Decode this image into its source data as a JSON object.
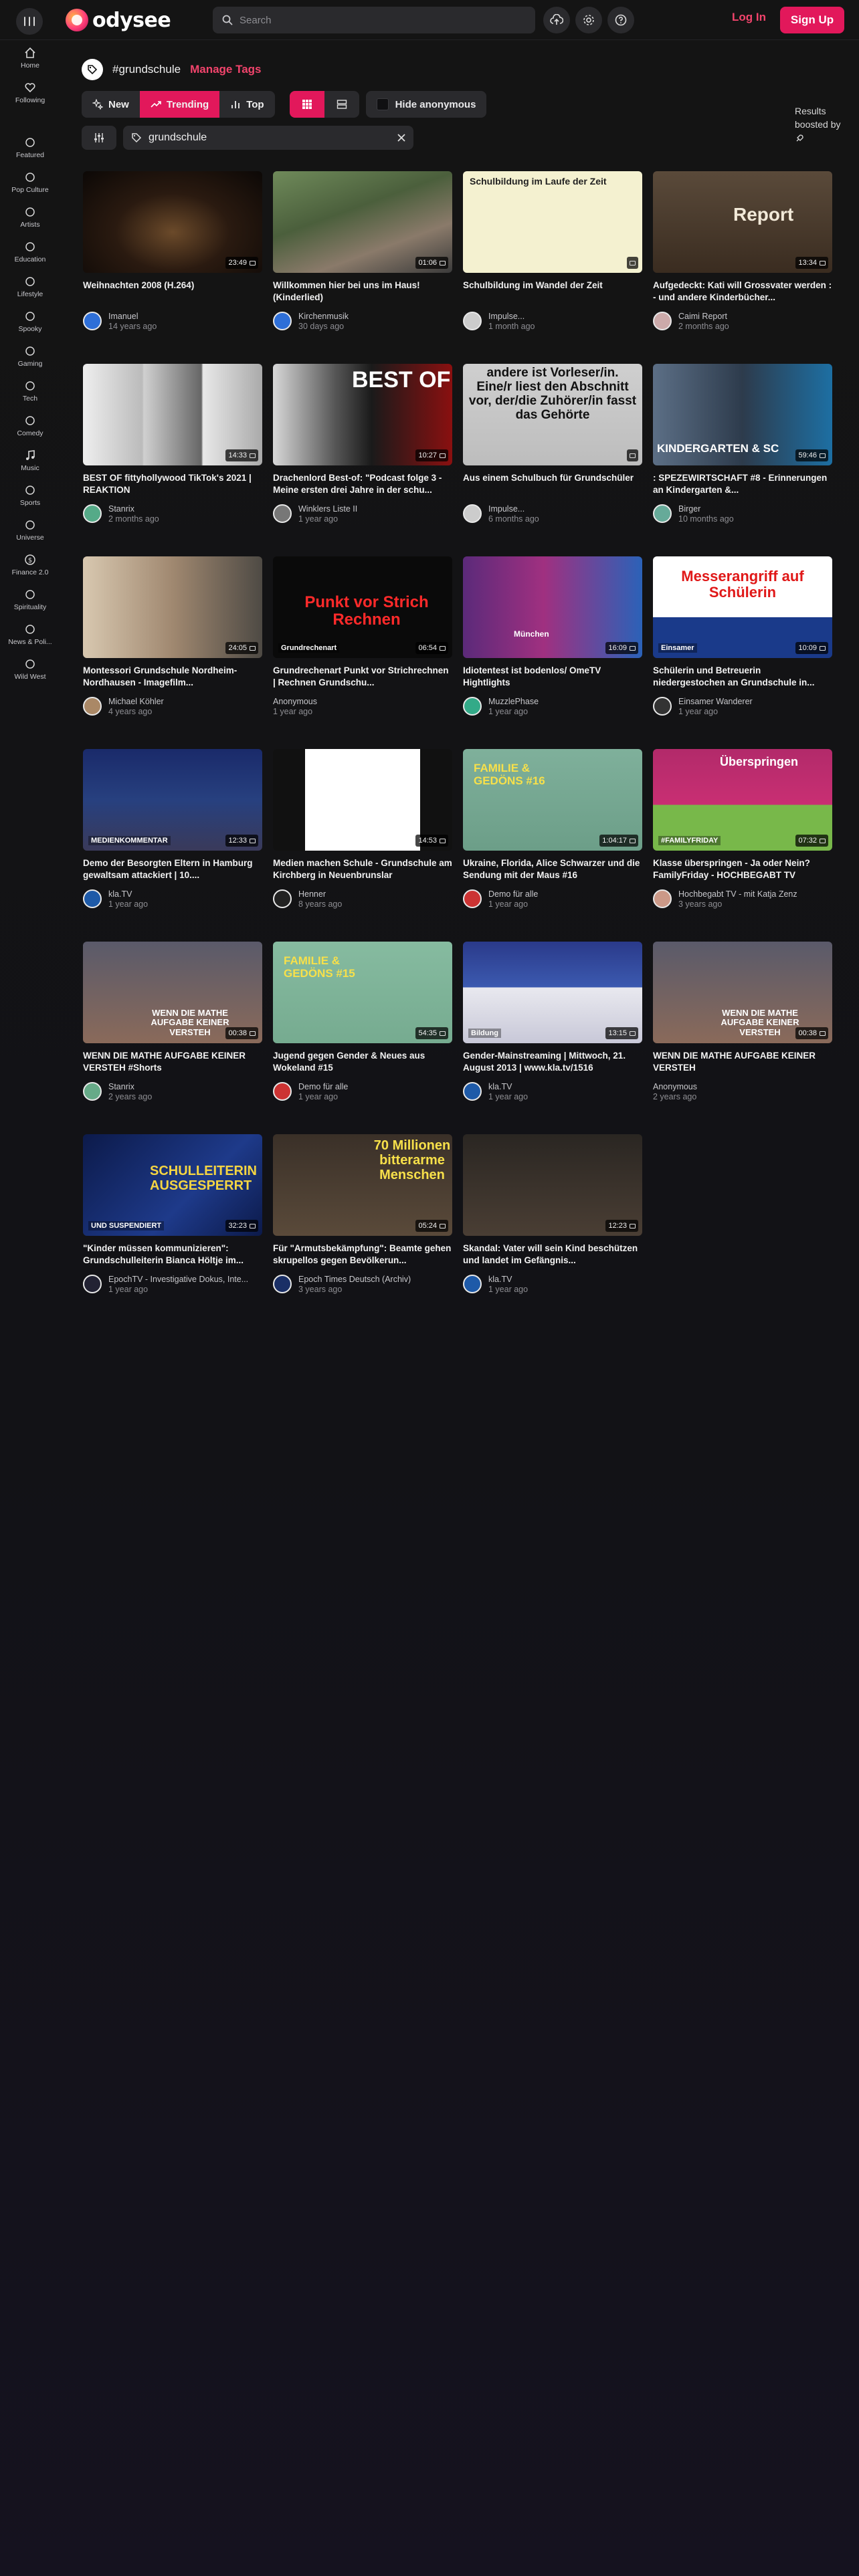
{
  "header": {
    "logo_text": "odysee",
    "search_placeholder": "Search",
    "login_label": "Log In",
    "signup_label": "Sign Up"
  },
  "sidebar": {
    "items": [
      {
        "label": "Home",
        "icon": "home-icon"
      },
      {
        "label": "Following",
        "icon": "heart-icon"
      },
      {
        "label": "Featured",
        "icon": "sparkle-icon"
      },
      {
        "label": "Pop Culture",
        "icon": "heart-outline-icon"
      },
      {
        "label": "Artists",
        "icon": "brush-icon"
      },
      {
        "label": "Education",
        "icon": "graduation-cap-icon"
      },
      {
        "label": "Lifestyle",
        "icon": "building-icon"
      },
      {
        "label": "Spooky",
        "icon": "ghost-icon"
      },
      {
        "label": "Gaming",
        "icon": "gamepad-icon"
      },
      {
        "label": "Tech",
        "icon": "chip-icon"
      },
      {
        "label": "Comedy",
        "icon": "smile-icon"
      },
      {
        "label": "Music",
        "icon": "music-note-icon"
      },
      {
        "label": "Sports",
        "icon": "basketball-icon"
      },
      {
        "label": "Universe",
        "icon": "rocket-icon"
      },
      {
        "label": "Finance 2.0",
        "icon": "dollar-icon"
      },
      {
        "label": "Spirituality",
        "icon": "lotus-icon"
      },
      {
        "label": "News & Poli...",
        "icon": "megaphone-icon"
      },
      {
        "label": "Wild West",
        "icon": "cowboy-hat-icon"
      }
    ]
  },
  "tag": {
    "title": "#grundschule",
    "manage_label": "Manage Tags"
  },
  "filters": {
    "new_label": "New",
    "trending_label": "Trending",
    "top_label": "Top",
    "hide_anonymous_label": "Hide anonymous",
    "search_value": "grundschule",
    "results_boosted": "Results boosted by"
  },
  "colors": {
    "accent": "#e2185b",
    "accent_text": "#f2446c",
    "background": "#141414",
    "control": "#2a2a2d"
  },
  "videos": [
    {
      "title": "Weihnachten 2008 (H.264)",
      "duration": "23:49",
      "channel": "Imanuel",
      "when": "14 years ago"
    },
    {
      "title": "Willkommen hier bei uns im Haus! (Kinderlied)",
      "duration": "01:06",
      "channel": "Kirchenmusik",
      "when": "30 days ago"
    },
    {
      "title": "Schulbildung im Wandel der Zeit",
      "thumb_text": "Schulbildung im Laufe der Zeit",
      "channel": "Impulse...",
      "when": "1 month ago"
    },
    {
      "title": "Aufgedeckt: Kati will Grossvater werden : - und andere Kinderbücher...",
      "thumb_text": "Report",
      "duration": "13:34",
      "channel": "Caimi Report",
      "when": "2 months ago"
    },
    {
      "title": "BEST OF fittyhollywood TikTok's 2021 | REAKTION",
      "duration": "14:33",
      "channel": "Stanrix",
      "when": "2 months ago"
    },
    {
      "title": "Drachenlord Best-of: \"Podcast folge 3 - Meine ersten drei Jahre in der schu...",
      "thumb_text": "BEST OF",
      "duration": "10:27",
      "channel": "Winklers Liste II",
      "when": "1 year ago"
    },
    {
      "title": "Aus einem Schulbuch für Grundschüler",
      "thumb_text": "andere ist Vorleser/in. Eine/r liest den Abschnitt vor, der/die Zuhörer/in fasst das Gehörte",
      "channel": "Impulse...",
      "when": "6 months ago"
    },
    {
      "title": ": SPEZEWIRTSCHAFT #8 - Erinnerungen an Kindergarten &...",
      "thumb_text": "KINDERGARTEN & SC",
      "duration": "59:46",
      "channel": "Birger",
      "when": "10 months ago"
    },
    {
      "title": "Montessori Grundschule Nordheim-Nordhausen - Imagefilm...",
      "duration": "24:05",
      "channel": "Michael Köhler",
      "when": "4 years ago"
    },
    {
      "title": "Grundrechenart Punkt vor Strichrechnen | Rechnen Grundschu...",
      "thumb_text": "Punkt vor Strich Rechnen",
      "thumb_sub": "Grundrechenart",
      "duration": "06:54",
      "channel": "Anonymous",
      "when": "1 year ago"
    },
    {
      "title": "Idiotentest ist bodenlos/ OmeTV Hightlights",
      "thumb_text": "München",
      "duration": "16:09",
      "channel": "MuzzlePhase",
      "when": "1 year ago"
    },
    {
      "title": "Schülerin und Betreuerin niedergestochen an Grundschule in...",
      "thumb_text": "Messerangriff auf Schülerin",
      "thumb_sub": "Einsamer",
      "duration": "10:09",
      "channel": "Einsamer Wanderer",
      "when": "1 year ago"
    },
    {
      "title": "Demo der Besorgten Eltern in Hamburg gewaltsam attackiert | 10....",
      "thumb_sub": "MEDIENKOMMENTAR",
      "duration": "12:33",
      "channel": "kla.TV",
      "when": "1 year ago"
    },
    {
      "title": "Medien machen Schule - Grundschule am Kirchberg in Neuenbrunslar",
      "duration": "14:53",
      "channel": "Henner",
      "when": "8 years ago"
    },
    {
      "title": "Ukraine, Florida, Alice Schwarzer und die Sendung mit der Maus #16",
      "thumb_text": "FAMILIE & GEDÖNS #16",
      "duration": "1:04:17",
      "channel": "Demo für alle",
      "when": "1 year ago"
    },
    {
      "title": "Klasse überspringen - Ja oder Nein? FamilyFriday - HOCHBEGABT TV",
      "thumb_text": "Überspringen",
      "thumb_sub": "#FAMILYFRIDAY",
      "duration": "07:32",
      "channel": "Hochbegabt TV - mit Katja Zenz",
      "when": "3 years ago"
    },
    {
      "title": "WENN DIE MATHE AUFGABE KEINER VERSTEH #Shorts",
      "thumb_text": "WENN DIE MATHE AUFGABE KEINER VERSTEH",
      "duration": "00:38",
      "channel": "Stanrix",
      "when": "2 years ago"
    },
    {
      "title": "Jugend gegen Gender & Neues aus Wokeland #15",
      "thumb_text": "FAMILIE & GEDÖNS #15",
      "duration": "54:35",
      "channel": "Demo für alle",
      "when": "1 year ago"
    },
    {
      "title": "Gender-Mainstreaming | Mittwoch, 21. August 2013 | www.kla.tv/1516",
      "thumb_sub": "Bildung",
      "duration": "13:15",
      "channel": "kla.TV",
      "when": "1 year ago"
    },
    {
      "title": "WENN DIE MATHE AUFGABE KEINER VERSTEH",
      "thumb_text": "WENN DIE MATHE AUFGABE KEINER VERSTEH",
      "duration": "00:38",
      "channel": "Anonymous",
      "when": "2 years ago"
    },
    {
      "title": "\"Kinder müssen kommunizieren\": Grundschulleiterin Bianca Höltje im...",
      "thumb_text": "SCHULLEITERIN AUSGESPERRT",
      "thumb_sub": "UND SUSPENDIERT",
      "duration": "32:23",
      "channel": "EpochTV - Investigative Dokus, Inte...",
      "when": "1 year ago"
    },
    {
      "title": "Für \"Armutsbekämpfung\": Beamte gehen skrupellos gegen Bevölkerun...",
      "thumb_text": "70 Millionen bitterarme Menschen",
      "duration": "05:24",
      "channel": "Epoch Times Deutsch (Archiv)",
      "when": "3 years ago"
    },
    {
      "title": "Skandal: Vater will sein Kind beschützen und landet im Gefängnis...",
      "duration": "12:23",
      "channel": "kla.TV",
      "when": "1 year ago"
    }
  ]
}
